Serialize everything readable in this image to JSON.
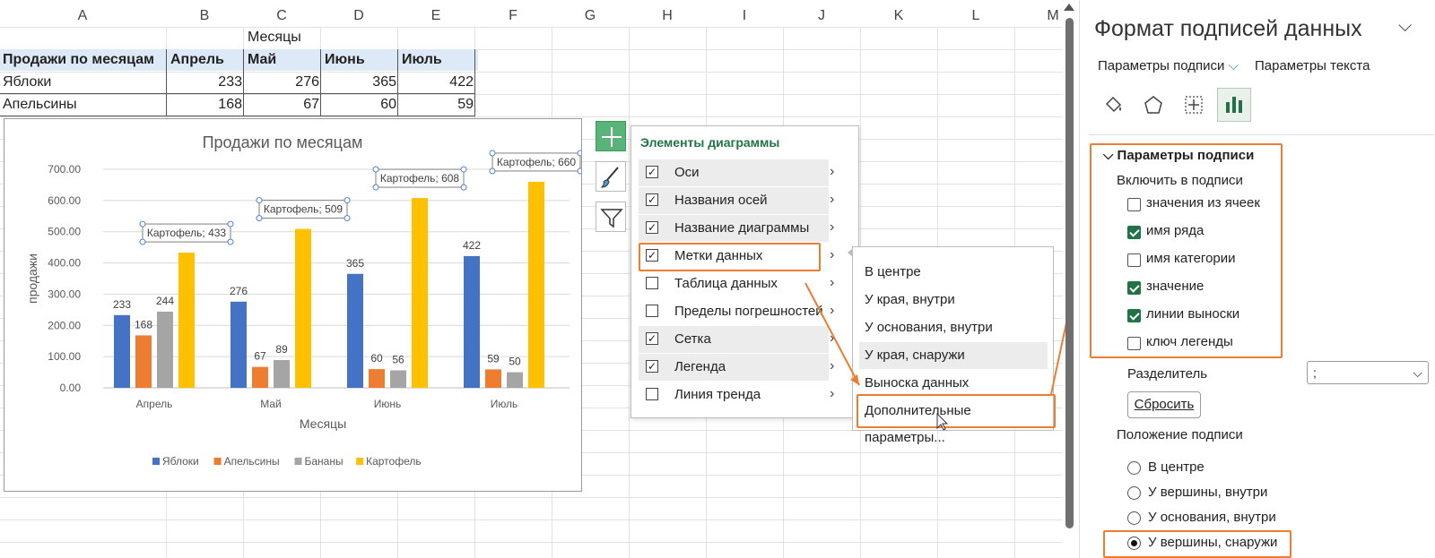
{
  "columns": [
    "A",
    "B",
    "C",
    "D",
    "E",
    "F",
    "G",
    "H",
    "I",
    "J",
    "K",
    "L",
    "M"
  ],
  "table": {
    "title_cell": "Месяцы",
    "header": [
      "Продажи по месяцам",
      "Апрель",
      "Май",
      "Июнь",
      "Июль"
    ],
    "rows": [
      {
        "name": "Яблоки",
        "values": [
          "233",
          "276",
          "365",
          "422"
        ]
      },
      {
        "name": "Апельсины",
        "values": [
          "168",
          "67",
          "60",
          "59"
        ]
      }
    ]
  },
  "chart_data": {
    "type": "bar",
    "title": "Продажи по месяцам",
    "xlabel": "Месяцы",
    "ylabel": "продажи",
    "categories": [
      "Апрель",
      "Май",
      "Июнь",
      "Июль"
    ],
    "ylim": [
      0,
      700
    ],
    "yticks": [
      "0.00",
      "100.00",
      "200.00",
      "300.00",
      "400.00",
      "500.00",
      "600.00",
      "700.00"
    ],
    "series": [
      {
        "name": "Яблоки",
        "color": "#4472c4",
        "values": [
          233,
          276,
          365,
          422
        ]
      },
      {
        "name": "Апельсины",
        "color": "#ed7d31",
        "values": [
          168,
          67,
          60,
          59
        ]
      },
      {
        "name": "Бананы",
        "color": "#a5a5a5",
        "values": [
          244,
          89,
          56,
          50
        ]
      },
      {
        "name": "Картофель",
        "color": "#ffc000",
        "values": [
          433,
          509,
          608,
          660
        ]
      }
    ],
    "callouts": [
      "Картофель; 433",
      "Картофель; 509",
      "Картофель; 608",
      "Картофель; 660"
    ],
    "legend": "bottom",
    "grid": true
  },
  "menu": {
    "title": "Элементы диаграммы",
    "items": [
      {
        "label": "Оси",
        "checked": true
      },
      {
        "label": "Названия осей",
        "checked": true
      },
      {
        "label": "Название диаграммы",
        "checked": true
      },
      {
        "label": "Метки данных",
        "checked": true
      },
      {
        "label": "Таблица данных",
        "checked": false
      },
      {
        "label": "Пределы погрешностей",
        "checked": false
      },
      {
        "label": "Сетка",
        "checked": true
      },
      {
        "label": "Легенда",
        "checked": true
      },
      {
        "label": "Линия тренда",
        "checked": false
      }
    ]
  },
  "submenu": {
    "items": [
      "В центре",
      "У края, внутри",
      "У основания, внутри",
      "У края, снаружи",
      "Выноска данных",
      "Дополнительные параметры..."
    ]
  },
  "pane": {
    "title": "Формат подписей данных",
    "tab1": "Параметры подписи",
    "tab2": "Параметры текста",
    "section": "Параметры подписи",
    "include_label": "Включить в подписи",
    "checks": [
      {
        "label": "значения из ячеек",
        "checked": false
      },
      {
        "label": "имя ряда",
        "checked": true
      },
      {
        "label": "имя категории",
        "checked": false
      },
      {
        "label": "значение",
        "checked": true
      },
      {
        "label": "линии выноски",
        "checked": true
      },
      {
        "label": "ключ легенды",
        "checked": false
      }
    ],
    "separator_label": "Разделитель",
    "separator_value": ";",
    "reset_label": "Сбросить",
    "position_label": "Положение подписи",
    "positions": [
      {
        "label": "В центре",
        "selected": false
      },
      {
        "label": "У вершины, внутри",
        "selected": false
      },
      {
        "label": "У основания, внутри",
        "selected": false
      },
      {
        "label": "У вершины, снаружи",
        "selected": true
      }
    ]
  }
}
